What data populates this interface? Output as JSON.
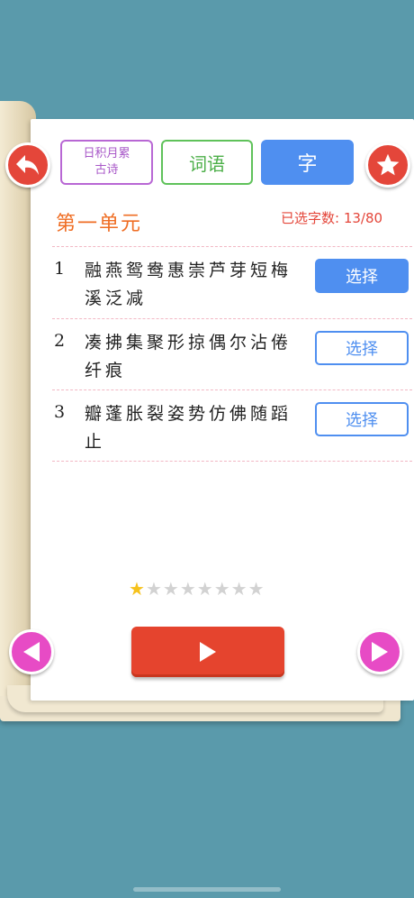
{
  "tabs": {
    "daily": {
      "line1": "日积月累",
      "line2": "古诗"
    },
    "words": {
      "label": "词语"
    },
    "chars": {
      "label": "字"
    }
  },
  "unit": {
    "title": "第一单元",
    "selected_label": "已选字数:",
    "selected_value": "13/80"
  },
  "rows": [
    {
      "num": "1",
      "chars": "融燕鸳鸯惠崇芦芽短梅溪泛减",
      "button": "选择",
      "state": "active"
    },
    {
      "num": "2",
      "chars": "凑拂集聚形掠偶尔沾倦纤痕",
      "button": "选择",
      "state": "inactive"
    },
    {
      "num": "3",
      "chars": "瓣蓬胀裂姿势仿佛随蹈止",
      "button": "选择",
      "state": "inactive"
    }
  ],
  "rating": {
    "filled": 1,
    "total": 8
  },
  "icons": {
    "back": "back-arrow-icon",
    "star": "star-icon",
    "prev": "triangle-left-icon",
    "next": "triangle-right-icon",
    "play": "play-icon"
  },
  "colors": {
    "background": "#5a9aab",
    "accent_red": "#e4463a",
    "accent_blue": "#4f8ff0",
    "accent_pink": "#e74bc5",
    "title_orange": "#ef6d23"
  }
}
